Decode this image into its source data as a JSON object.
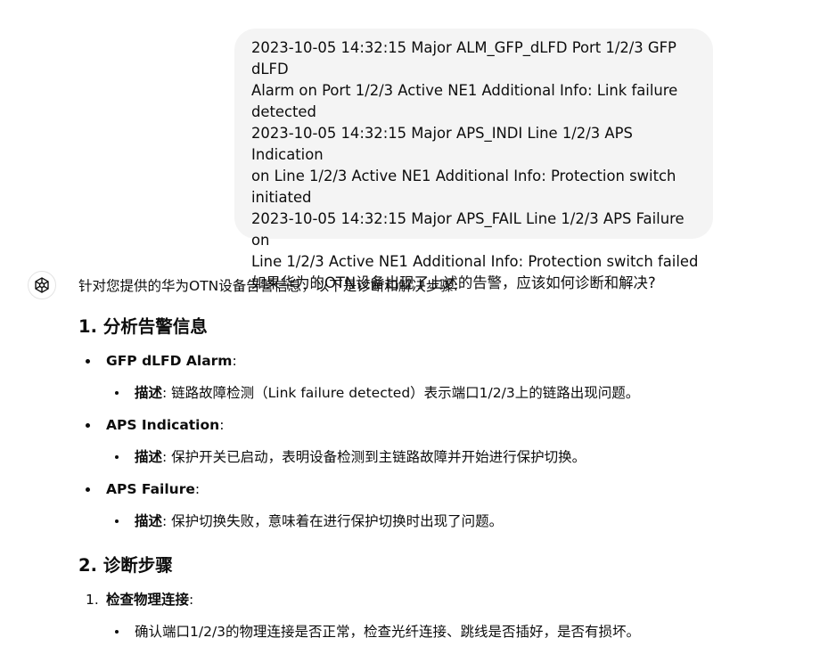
{
  "user_message": {
    "lines": [
      "2023-10-05 14:32:15 Major ALM_GFP_dLFD Port 1/2/3 GFP dLFD",
      "Alarm on Port 1/2/3 Active NE1 Additional Info: Link failure",
      "detected",
      "2023-10-05 14:32:15 Major APS_INDI Line 1/2/3 APS Indication",
      "on Line 1/2/3 Active NE1 Additional Info: Protection switch",
      "initiated",
      "2023-10-05 14:32:15 Major APS_FAIL Line 1/2/3 APS Failure on",
      "Line 1/2/3 Active NE1 Additional Info: Protection switch failed",
      "如果华为的OTN设备出现了上述的告警，应该如何诊断和解决?"
    ]
  },
  "assistant": {
    "avatar_icon": "openai-logo-icon",
    "intro": "针对您提供的华为OTN设备告警信息，以下是诊断和解决步骤:",
    "section1": {
      "heading": "1. 分析告警信息",
      "items": [
        {
          "title": "GFP dLFD Alarm",
          "colon": ":",
          "sub_label": "描述",
          "sub_text": ": 链路故障检测（Link failure detected）表示端口1/2/3上的链路出现问题。"
        },
        {
          "title": "APS Indication",
          "colon": ":",
          "sub_label": "描述",
          "sub_text": ": 保护开关已启动，表明设备检测到主链路故障并开始进行保护切换。"
        },
        {
          "title": "APS Failure",
          "colon": ":",
          "sub_label": "描述",
          "sub_text": ": 保护切换失败，意味着在进行保护切换时出现了问题。"
        }
      ]
    },
    "section2": {
      "heading": "2. 诊断步骤",
      "steps": [
        {
          "number": "1.",
          "title": "检查物理连接",
          "colon": ":",
          "sub_text": "确认端口1/2/3的物理连接是否正常，检查光纤连接、跳线是否插好，是否有损坏。"
        }
      ]
    }
  }
}
